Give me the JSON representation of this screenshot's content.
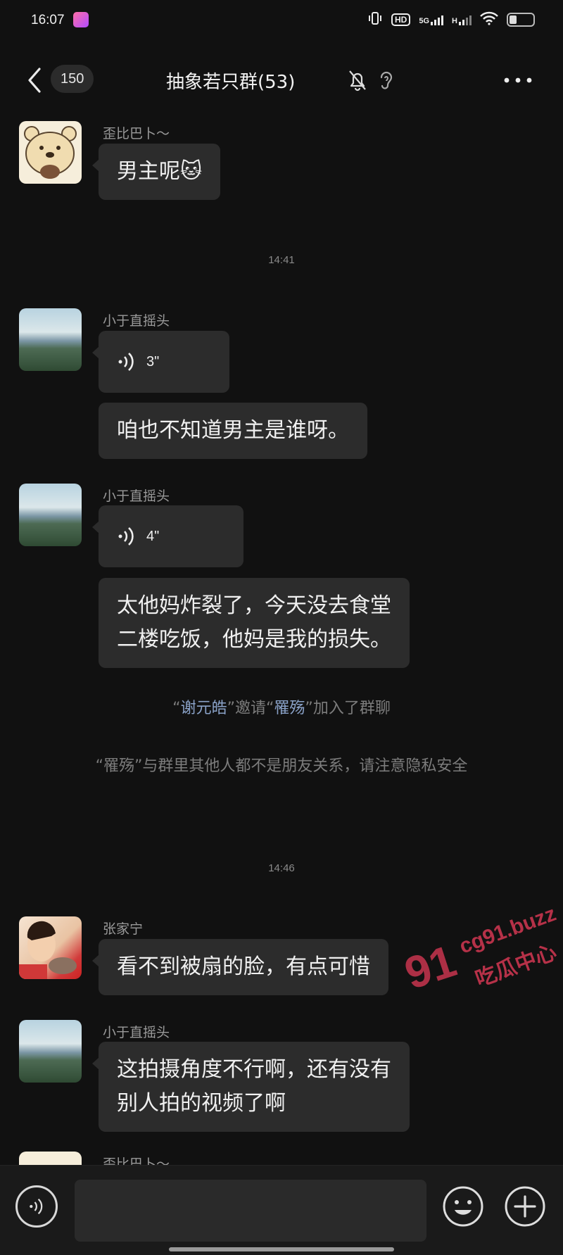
{
  "status_bar": {
    "time": "16:07",
    "network_5g": "5G",
    "network_h": "H",
    "hd_label": "HD",
    "battery_level": 0.25
  },
  "header": {
    "unread_count": "150",
    "title": "抽象若只群(53)"
  },
  "messages": [
    {
      "sender": "歪比巴卜～",
      "text": "男主呢🐱"
    },
    {
      "timestamp": "14:41"
    },
    {
      "sender": "小于直摇头",
      "voice_duration": "3\""
    },
    {
      "text": "咱也不知道男主是谁呀。"
    },
    {
      "sender": "小于直摇头",
      "voice_duration": "4\""
    },
    {
      "text": "太他妈炸裂了，今天没去食堂\n二楼吃饭，他妈是我的损失。"
    },
    {
      "system": {
        "inviter": "谢元皓",
        "invite_text": "邀请",
        "invitee": "罹殇",
        "join_text": "加入了群聊"
      }
    },
    {
      "system_notice": "“罹殇”与群里其他人都不是朋友关系，请注意隐私安全"
    },
    {
      "timestamp": "14:46"
    },
    {
      "sender": "张家宁",
      "text": "看不到被扇的脸，有点可惜"
    },
    {
      "sender": "小于直摇头",
      "text": "这拍摄角度不行啊，还有没有\n别人拍的视频了啊"
    },
    {
      "sender": "歪比巴卜～"
    }
  ],
  "system_quotes": {
    "open": "“",
    "close": "”"
  },
  "input": {
    "value": ""
  },
  "watermark": {
    "number": "91",
    "domain": "cg91.buzz",
    "name": "吃瓜中心"
  },
  "colors": {
    "background": "#111111",
    "bubble": "#2c2c2c",
    "link": "#8aa2c8",
    "watermark": "#c8354f"
  }
}
